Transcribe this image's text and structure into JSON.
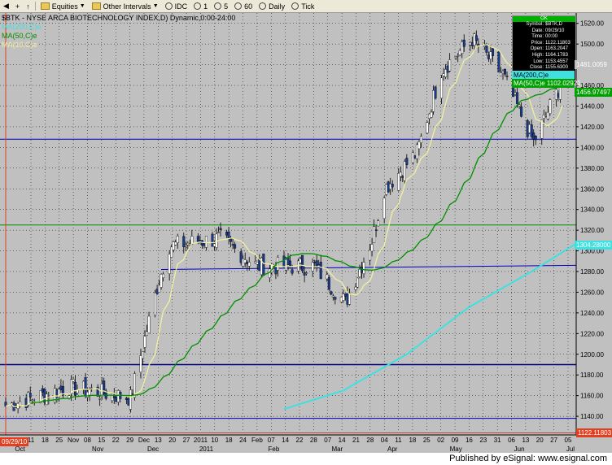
{
  "toolbar": {
    "items": [
      "Equities",
      "Other Intervals",
      "IDC",
      "1",
      "5",
      "60",
      "Daily",
      "Tick"
    ]
  },
  "chart_header": "$BTK - NYSE ARCA BIOTECHNOLOGY INDEX,D) Dynamic,0:00-24:00",
  "legend": [
    {
      "label": "MA(200,C)e",
      "color": "#40e0e0"
    },
    {
      "label": "MA(50,C)e",
      "color": "#009000"
    },
    {
      "label": "MA(10,C)e",
      "color": "#f0f0a0"
    }
  ],
  "info": {
    "status": "OK",
    "rows": [
      {
        "k": "Symbol:",
        "v": "$BTK,D"
      },
      {
        "k": "Date:",
        "v": "09/29/10"
      },
      {
        "k": "Time:",
        "v": "00:00"
      },
      {
        "k": "Price:",
        "v": "1122.11803"
      },
      {
        "k": "Open:",
        "v": "1163.2047"
      },
      {
        "k": "High:",
        "v": "1164.1783"
      },
      {
        "k": "Low:",
        "v": "1153.4557"
      },
      {
        "k": "Close:",
        "v": "1155.6300"
      }
    ]
  },
  "tags": {
    "ma200_info": "MA(200,C)e",
    "ma50_info": "MA(50,C)e  1102.02921",
    "price_1481": "1481.0059",
    "price_1456": "1456.97497",
    "price_1304": "1304.28000",
    "price_1122": "1122.11803",
    "cursor_date": "09/29/10"
  },
  "footer": "Published by eSignal: www.esignal.com",
  "chart_data": {
    "type": "candlestick",
    "title": "$BTK - NYSE ARCA BIOTECHNOLOGY INDEX,D) Dynamic,0:00-24:00",
    "ylim": [
      1122,
      1530
    ],
    "y_ticks": [
      1140,
      1160,
      1180,
      1200,
      1220,
      1240,
      1260,
      1280,
      1300,
      1320,
      1340,
      1360,
      1380,
      1400,
      1420,
      1440,
      1460,
      1480,
      1500,
      1520
    ],
    "x_day_ticks": [
      "11",
      "18",
      "25",
      "Nov",
      "08",
      "15",
      "22",
      "29",
      "Dec",
      "13",
      "20",
      "27",
      "2011",
      "10",
      "18",
      "24",
      "Feb",
      "07",
      "14",
      "22",
      "28",
      "07",
      "14",
      "21",
      "28",
      "04",
      "11",
      "18",
      "25",
      "02",
      "09",
      "16",
      "23",
      "31",
      "06",
      "13",
      "20",
      "27",
      "05"
    ],
    "x_month_labels": [
      "Oct",
      "Nov",
      "Dec",
      "2011",
      "Feb",
      "Mar",
      "Apr",
      "May",
      "Jun",
      "Jul"
    ],
    "key_closes": [
      {
        "date": "2010-10-01",
        "close": 1150
      },
      {
        "date": "2010-11-01",
        "close": 1168
      },
      {
        "date": "2010-12-01",
        "close": 1158
      },
      {
        "date": "2010-12-14",
        "close": 1265
      },
      {
        "date": "2010-12-20",
        "close": 1305
      },
      {
        "date": "2011-01-14",
        "close": 1312
      },
      {
        "date": "2011-02-01",
        "close": 1285
      },
      {
        "date": "2011-03-01",
        "close": 1285
      },
      {
        "date": "2011-03-16",
        "close": 1250
      },
      {
        "date": "2011-03-29",
        "close": 1310
      },
      {
        "date": "2011-04-04",
        "close": 1360
      },
      {
        "date": "2011-04-20",
        "close": 1395
      },
      {
        "date": "2011-05-02",
        "close": 1475
      },
      {
        "date": "2011-05-17",
        "close": 1505
      },
      {
        "date": "2011-06-01",
        "close": 1470
      },
      {
        "date": "2011-06-16",
        "close": 1405
      },
      {
        "date": "2011-06-30",
        "close": 1465
      }
    ],
    "horizontal_lines": [
      {
        "y": 1408,
        "color": "#0000c0"
      },
      {
        "y": 1325,
        "color": "#009000"
      },
      {
        "y": 1190,
        "color": "#000080"
      },
      {
        "y": 1138,
        "color": "#0000c0"
      },
      {
        "y": 1124,
        "color": "#c04040"
      }
    ],
    "series": [
      {
        "name": "MA(200,C)e",
        "color": "#40e0e0"
      },
      {
        "name": "MA(50,C)e",
        "color": "#009000"
      },
      {
        "name": "MA(10,C)e",
        "color": "#f0f0a0"
      }
    ]
  }
}
